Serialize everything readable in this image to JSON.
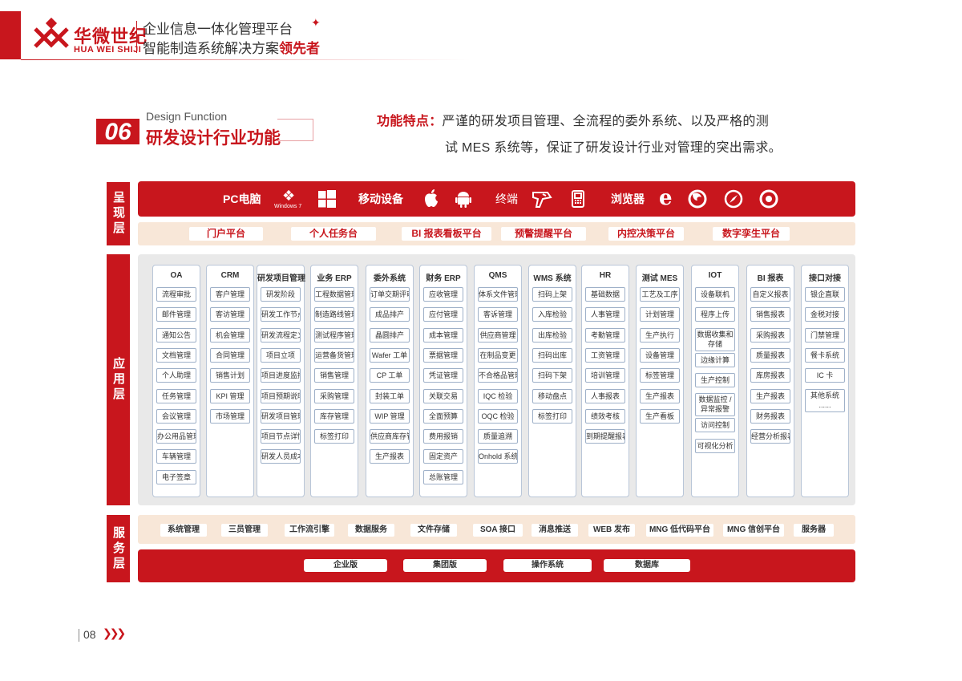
{
  "header": {
    "brand_cn": "华微世纪",
    "brand_en": "HUA WEI SHIJI",
    "tagline1": "企业信息一体化管理平台",
    "tagline2_prefix": "智能制造系统解决方案",
    "tagline2_emphasis": "领先者"
  },
  "section": {
    "number": "06",
    "title_en": "Design Function",
    "title_cn": "研发设计行业功能",
    "feature_label": "功能特点：",
    "feature_line1": "严谨的研发项目管理、全流程的委外系统、以及严格的测",
    "feature_line2": "试 MES 系统等，保证了研发设计行业对管理的突出需求。"
  },
  "layers": {
    "presentation": "呈现层",
    "application": "应用层",
    "service": "服务层"
  },
  "devices": {
    "pc": "PC电脑",
    "windows7": "Windows 7",
    "mobile": "移动设备",
    "terminal": "终端",
    "browser": "浏览器"
  },
  "platforms": [
    "门户平台",
    "个人任务台",
    "BI 报表看板平台",
    "预警提醒平台",
    "内控决策平台",
    "数字孪生平台"
  ],
  "modules": [
    {
      "title": "OA",
      "items": [
        "流程审批",
        "邮件管理",
        "通知公告",
        "文档管理",
        "个人助理",
        "任务管理",
        "会议管理",
        "办公用品管理",
        "车辆管理",
        "电子签章"
      ]
    },
    {
      "title": "CRM",
      "items": [
        "客户管理",
        "客访管理",
        "机会管理",
        "合同管理",
        "销售计划",
        "KPI 管理",
        "市场管理"
      ]
    },
    {
      "title": "研发项目管理",
      "items": [
        "研发阶段",
        "研发工作节点",
        "研发流程定义",
        "项目立项",
        "项目进度监控",
        "项目预期说明",
        "研发项目管理",
        "项目节点详情",
        "研发人员成本"
      ]
    },
    {
      "title": "业务 ERP",
      "items": [
        "工程数据管理",
        "制造路线管理",
        "测试程序管理",
        "运营备货管理",
        "销售管理",
        "采购管理",
        "库存管理",
        "标签打印"
      ]
    },
    {
      "title": "委外系统",
      "items": [
        "订单交期评审",
        "成品排产",
        "晶圆排产",
        "Wafer 工单",
        "CP 工单",
        "封装工单",
        "WIP 管理",
        "供应商库存管理",
        "生产报表"
      ]
    },
    {
      "title": "财务 ERP",
      "items": [
        "应收管理",
        "应付管理",
        "成本管理",
        "票据管理",
        "凭证管理",
        "关联交易",
        "全面预算",
        "费用报销",
        "固定资产",
        "总账管理"
      ]
    },
    {
      "title": "QMS",
      "items": [
        "体系文件管理",
        "客诉管理",
        "供应商管理",
        "在制品变更",
        "不合格品管理",
        "IQC 检验",
        "OQC 检验",
        "质量追溯",
        "Onhold 系统"
      ]
    },
    {
      "title": "WMS 系统",
      "items": [
        "扫码上架",
        "入库检验",
        "出库检验",
        "扫码出库",
        "扫码下架",
        "移动盘点",
        "标签打印"
      ]
    },
    {
      "title": "HR",
      "items": [
        "基础数据",
        "人事管理",
        "考勤管理",
        "工资管理",
        "培训管理",
        "人事报表",
        "绩效考核",
        "到期提醒报表"
      ]
    },
    {
      "title": "测试 MES",
      "items": [
        "工艺及工序",
        "计划管理",
        "生产执行",
        "设备管理",
        "标签管理",
        "生产报表",
        "生产看板"
      ]
    },
    {
      "title": "IOT",
      "items": [
        "设备联机",
        "程序上传",
        "数据收集和存储",
        "边缘计算",
        "生产控制",
        "数据监控 / 异常报警",
        "访问控制",
        "可视化分析"
      ]
    },
    {
      "title": "BI 报表",
      "items": [
        "自定义报表",
        "销售报表",
        "采购报表",
        "质量报表",
        "库房报表",
        "生产报表",
        "财务报表",
        "经营分析报表"
      ]
    },
    {
      "title": "接口对接",
      "items": [
        "银企直联",
        "金税对接",
        "门禁管理",
        "餐卡系统",
        "IC 卡",
        "其他系统 ......"
      ]
    }
  ],
  "services": [
    "系统管理",
    "三员管理",
    "工作流引擎",
    "数据服务",
    "文件存储",
    "SOA 接口",
    "消息推送",
    "WEB 发布",
    "MNG 低代码平台",
    "MNG 信创平台",
    "服务器"
  ],
  "versions": [
    "企业版",
    "集团版",
    "操作系统",
    "数据库"
  ],
  "page_number": "08",
  "colors": {
    "brand_red": "#c8161d",
    "cream": "#f8e7d8",
    "panel_gray": "#e9e9e9"
  }
}
